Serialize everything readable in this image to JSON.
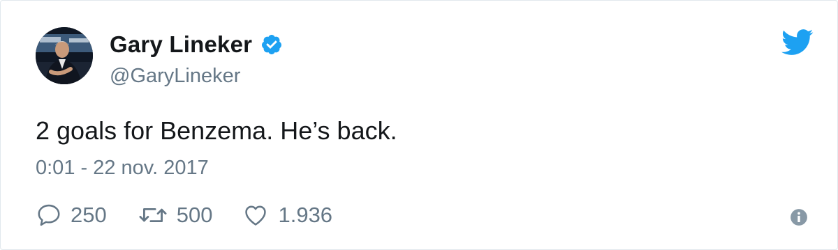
{
  "author": {
    "name": "Gary Lineker",
    "handle": "@GaryLineker",
    "avatar_icon": "profile-photo",
    "verified_icon": "verified-badge-icon"
  },
  "tweet": {
    "text": "2 goals for Benzema. He’s back.",
    "timestamp": "0:01 - 22 nov. 2017"
  },
  "actions": {
    "reply": {
      "icon": "speech-bubble-icon",
      "count": "250"
    },
    "retweet": {
      "icon": "retweet-arrows-icon",
      "count": "500"
    },
    "like": {
      "icon": "heart-icon",
      "count": "1.936"
    },
    "info_icon": "info-circle-icon"
  },
  "brand": {
    "logo_icon": "twitter-bird-icon",
    "accent_color": "#1da1f2",
    "text_color": "#14171a",
    "muted_color": "#657786",
    "border_color": "#e1e8ed"
  }
}
